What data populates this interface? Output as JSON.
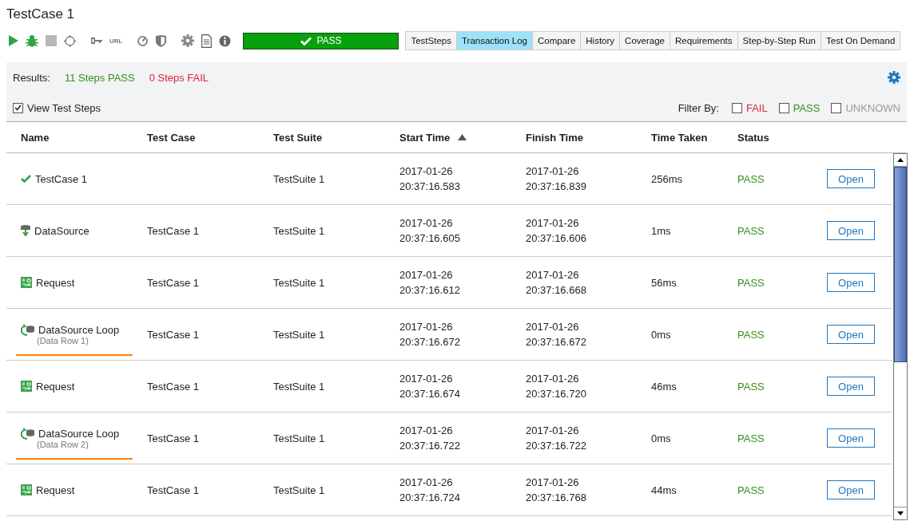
{
  "title": "TestCase 1",
  "toolbar": {
    "url_label": "URL",
    "status": "PASS"
  },
  "tabs": [
    {
      "label": "TestSteps",
      "selected": false
    },
    {
      "label": "Transaction Log",
      "selected": true
    },
    {
      "label": "Compare",
      "selected": false
    },
    {
      "label": "History",
      "selected": false
    },
    {
      "label": "Coverage",
      "selected": false
    },
    {
      "label": "Requirements",
      "selected": false
    },
    {
      "label": "Step-by-Step Run",
      "selected": false
    },
    {
      "label": "Test On Demand",
      "selected": false
    }
  ],
  "results": {
    "label": "Results:",
    "pass": "11 Steps PASS",
    "fail": "0 Steps FAIL"
  },
  "view_test_steps": {
    "label": "View Test Steps",
    "checked": true
  },
  "filter": {
    "label": "Filter By:",
    "options": [
      {
        "label": "FAIL",
        "kind": "fail",
        "checked": false
      },
      {
        "label": "PASS",
        "kind": "pass",
        "checked": false
      },
      {
        "label": "UNKNOWN",
        "kind": "unknown",
        "checked": false
      }
    ]
  },
  "table": {
    "columns": [
      {
        "label": "Name",
        "sorted": false
      },
      {
        "label": "Test Case",
        "sorted": false
      },
      {
        "label": "Test Suite",
        "sorted": false
      },
      {
        "label": "Start Time",
        "sorted": true
      },
      {
        "label": "Finish Time",
        "sorted": false
      },
      {
        "label": "Time Taken",
        "sorted": false
      },
      {
        "label": "Status",
        "sorted": false
      }
    ],
    "rows": [
      {
        "kind": "testcase",
        "name": "TestCase 1",
        "test_case": "",
        "test_suite": "TestSuite 1",
        "start_date": "2017-01-26",
        "start_time": "20:37:16.583",
        "finish_date": "2017-01-26",
        "finish_time": "20:37:16.839",
        "time_taken": "256ms",
        "status": "PASS",
        "action": "Open",
        "underlined": false
      },
      {
        "kind": "datasource",
        "name": "DataSource",
        "test_case": "TestCase 1",
        "test_suite": "TestSuite 1",
        "start_date": "2017-01-26",
        "start_time": "20:37:16.605",
        "finish_date": "2017-01-26",
        "finish_time": "20:37:16.606",
        "time_taken": "1ms",
        "status": "PASS",
        "action": "Open",
        "underlined": false
      },
      {
        "kind": "request",
        "name": "Request",
        "test_case": "TestCase 1",
        "test_suite": "TestSuite 1",
        "start_date": "2017-01-26",
        "start_time": "20:37:16.612",
        "finish_date": "2017-01-26",
        "finish_time": "20:37:16.668",
        "time_taken": "56ms",
        "status": "PASS",
        "action": "Open",
        "underlined": false
      },
      {
        "kind": "loop",
        "name": "DataSource Loop",
        "sub": "(Data Row 1)",
        "test_case": "TestCase 1",
        "test_suite": "TestSuite 1",
        "start_date": "2017-01-26",
        "start_time": "20:37:16.672",
        "finish_date": "2017-01-26",
        "finish_time": "20:37:16.672",
        "time_taken": "0ms",
        "status": "PASS",
        "action": "Open",
        "underlined": true
      },
      {
        "kind": "request",
        "name": "Request",
        "test_case": "TestCase 1",
        "test_suite": "TestSuite 1",
        "start_date": "2017-01-26",
        "start_time": "20:37:16.674",
        "finish_date": "2017-01-26",
        "finish_time": "20:37:16.720",
        "time_taken": "46ms",
        "status": "PASS",
        "action": "Open",
        "underlined": false
      },
      {
        "kind": "loop",
        "name": "DataSource Loop",
        "sub": "(Data Row 2)",
        "test_case": "TestCase 1",
        "test_suite": "TestSuite 1",
        "start_date": "2017-01-26",
        "start_time": "20:37:16.722",
        "finish_date": "2017-01-26",
        "finish_time": "20:37:16.722",
        "time_taken": "0ms",
        "status": "PASS",
        "action": "Open",
        "underlined": true
      },
      {
        "kind": "request",
        "name": "Request",
        "test_case": "TestCase 1",
        "test_suite": "TestSuite 1",
        "start_date": "2017-01-26",
        "start_time": "20:37:16.724",
        "finish_date": "2017-01-26",
        "finish_time": "20:37:16.768",
        "time_taken": "44ms",
        "status": "PASS",
        "action": "Open",
        "underlined": false
      }
    ]
  }
}
